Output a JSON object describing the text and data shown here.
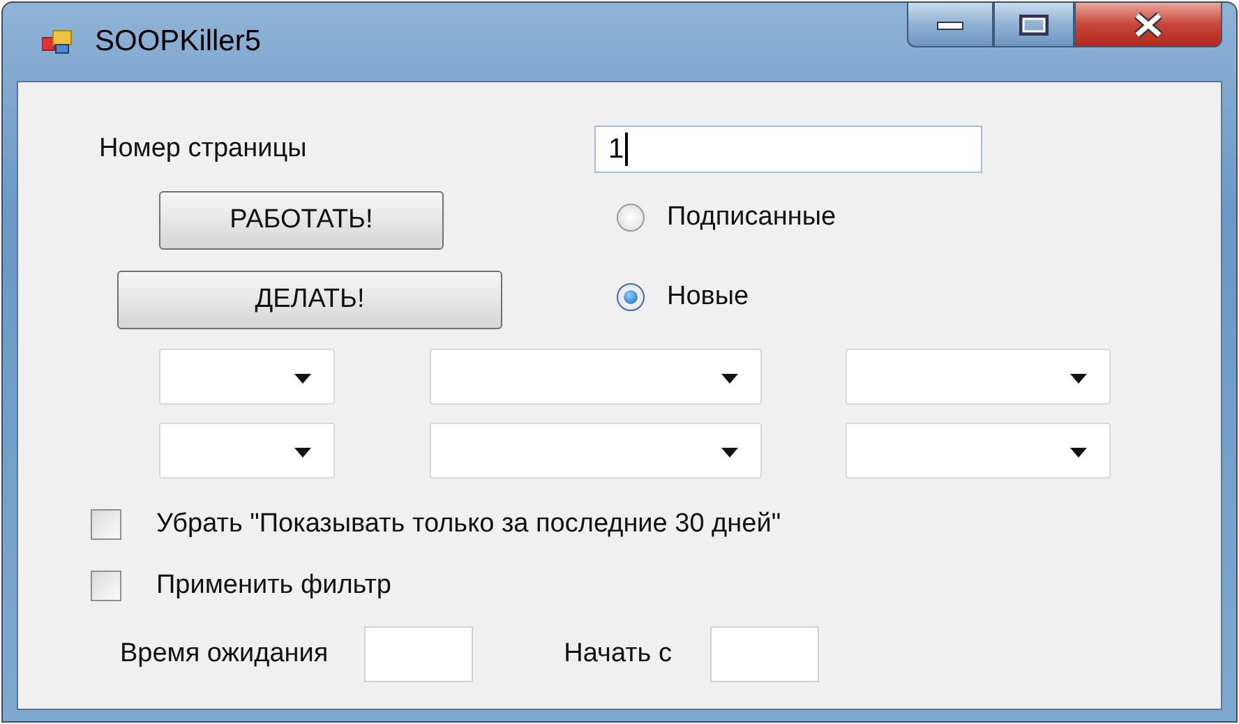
{
  "window": {
    "title": "SOOPKiller5"
  },
  "page_number": {
    "label": "Номер страницы",
    "value": "1"
  },
  "buttons": [
    {
      "label": "РАБОТАТЬ!"
    },
    {
      "label": "ДЕЛАТЬ!"
    }
  ],
  "radios": [
    {
      "label": "Подписанные",
      "selected": false
    },
    {
      "label": "Новые",
      "selected": true
    }
  ],
  "dropdown_rows": [
    [
      {
        "kind": "dropdown"
      },
      {
        "kind": "dropdown"
      },
      {
        "kind": "dropdown"
      }
    ],
    [
      {
        "kind": "dropdown"
      },
      {
        "kind": "dropdown"
      },
      {
        "kind": "dropdown"
      }
    ]
  ],
  "checkboxes": [
    {
      "label": "Убрать \"Показывать только за последние 30 дней\"",
      "checked": false
    },
    {
      "label": "Применить фильтр",
      "checked": false
    }
  ],
  "bottom_fields": [
    {
      "label": "Время ожидания"
    },
    {
      "label": "Начать с"
    }
  ]
}
